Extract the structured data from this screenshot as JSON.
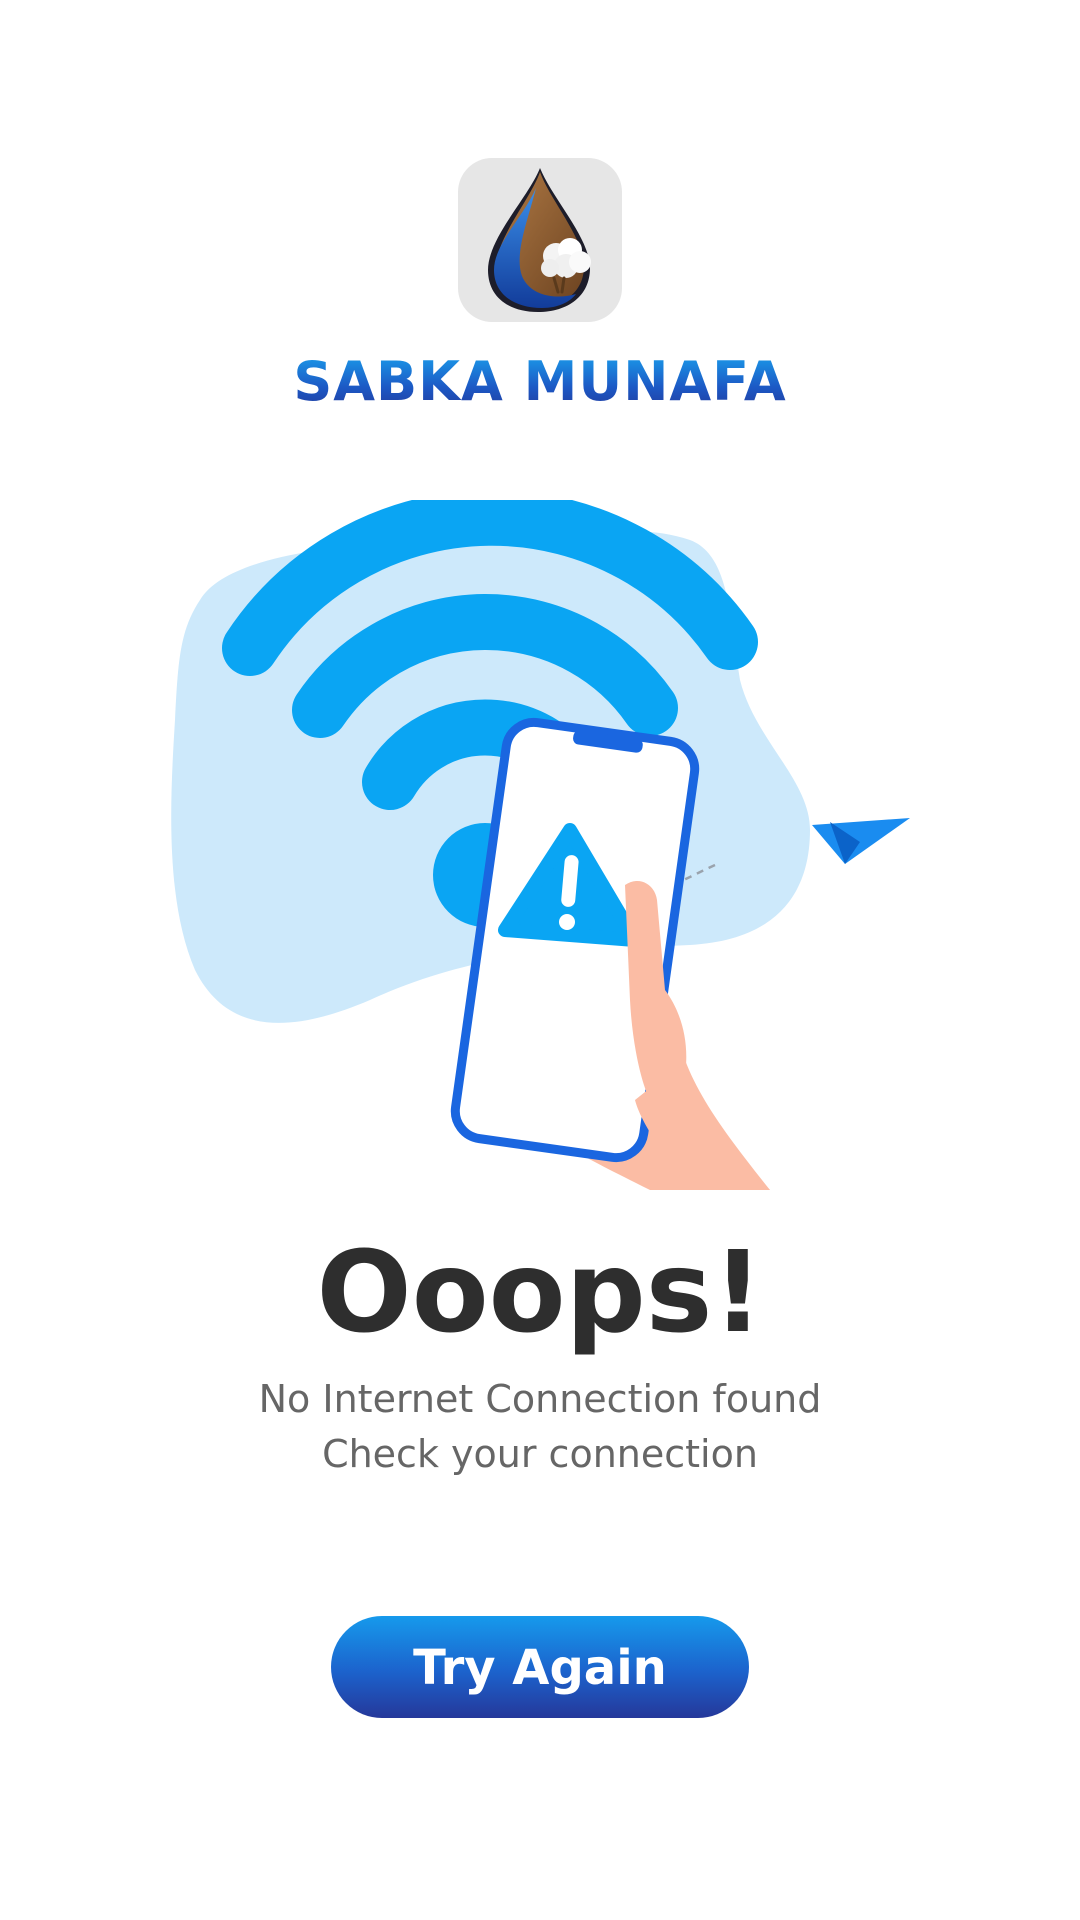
{
  "brand": {
    "name": "SABKA MUNAFA",
    "logo_icon": "water-drop-cotton-icon"
  },
  "illustration": {
    "icon": "no-wifi-phone-illustration",
    "colors": {
      "wifi": "#0aa5f3",
      "blob": "#cde9fb",
      "phone_outline": "#1a66e0",
      "warning": "#0aa5f3",
      "hand": "#fbbca4",
      "plane": "#1a8cf0"
    }
  },
  "error": {
    "headline": "Ooops!",
    "line1": "No Internet Connection found",
    "line2": "Check your connection"
  },
  "actions": {
    "retry_label": "Try Again"
  },
  "colors": {
    "brand_gradient_top": "#1aa2ee",
    "brand_gradient_bottom": "#23399a",
    "headline": "#2e2e2e",
    "message": "#666666"
  }
}
